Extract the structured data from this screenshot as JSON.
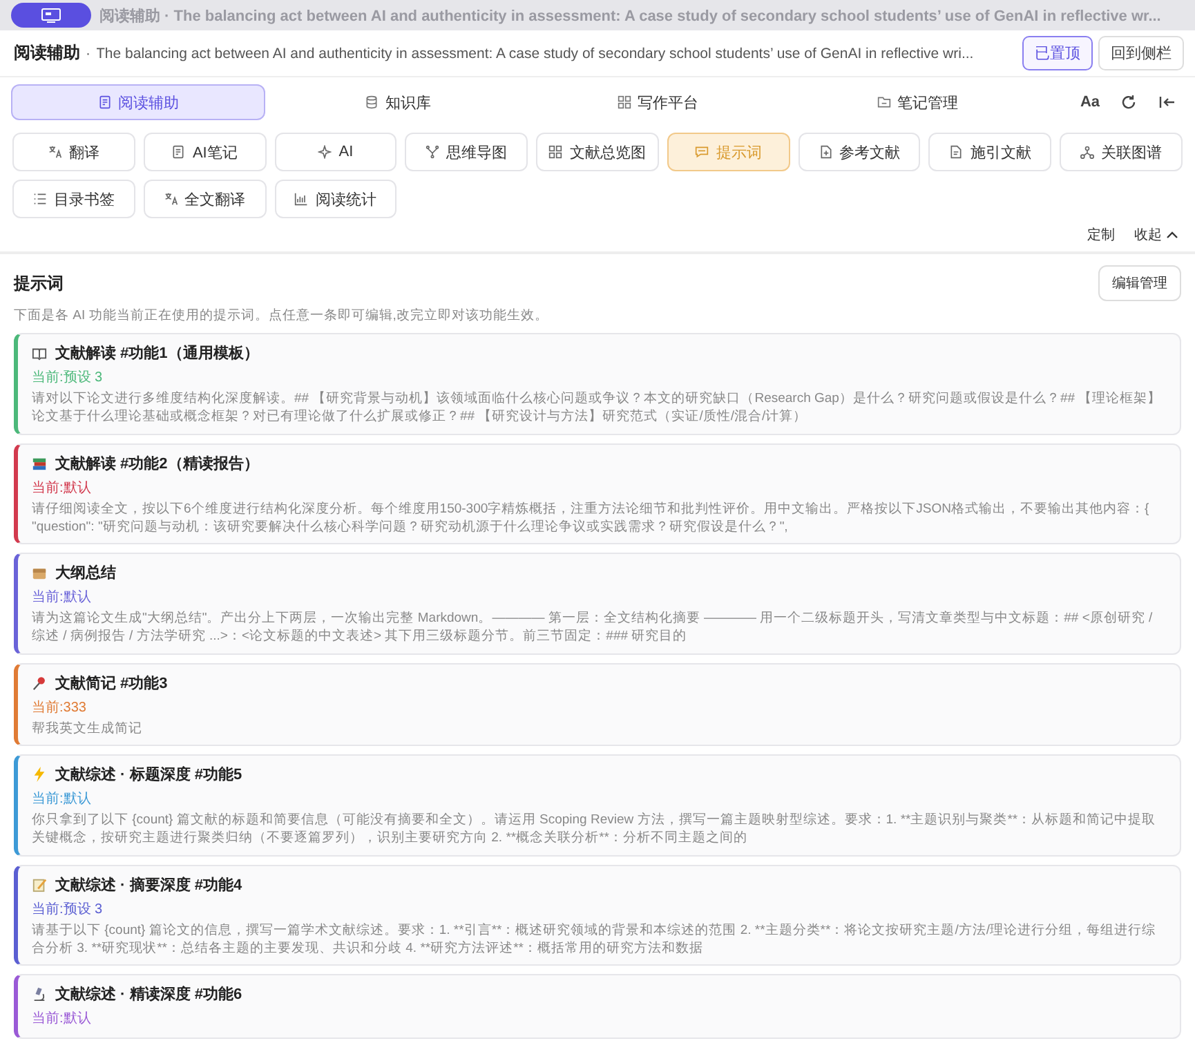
{
  "top_bar": {
    "title": "阅读辅助 · The balancing act between AI and authenticity in assessment: A case study of secondary school students’ use of GenAI in reflective wr..."
  },
  "header": {
    "module": "阅读辅助",
    "separator": "·",
    "title": "The balancing act between AI and authenticity in assessment: A case study of secondary school students’ use of GenAI in reflective wri...",
    "buttons": [
      {
        "label": "已置顶",
        "selected": true
      },
      {
        "label": "回到侧栏",
        "selected": false
      }
    ]
  },
  "tabs": [
    {
      "label": "阅读辅助",
      "selected": true
    },
    {
      "label": "知识库",
      "selected": false
    },
    {
      "label": "写作平台",
      "selected": false
    },
    {
      "label": "笔记管理",
      "selected": false
    }
  ],
  "font_button": "Aa",
  "tools": [
    {
      "label": "翻译",
      "selected": false
    },
    {
      "label": "AI笔记",
      "selected": false
    },
    {
      "label": "AI",
      "selected": false
    },
    {
      "label": "思维导图",
      "selected": false
    },
    {
      "label": "文献总览图",
      "selected": false
    },
    {
      "label": "提示词",
      "selected": true
    },
    {
      "label": "参考文献",
      "selected": false
    },
    {
      "label": "施引文献",
      "selected": false
    },
    {
      "label": "关联图谱",
      "selected": false
    },
    {
      "label": "目录书签",
      "selected": false
    },
    {
      "label": "全文翻译",
      "selected": false
    },
    {
      "label": "阅读统计",
      "selected": false
    }
  ],
  "tool_actions": {
    "customize": "定制",
    "collapse": "收起"
  },
  "panel": {
    "title": "提示词",
    "manage_button": "编辑管理",
    "description": "下面是各 AI 功能当前正在使用的提示词。点任意一条即可编辑,改完立即对该功能生效。"
  },
  "prompts": [
    {
      "kind": "book",
      "title": "文献解读 #功能1（通用模板）",
      "current": "当前:预设 3",
      "color": "#4cb87a",
      "text": "请对以下论文进行多维度结构化深度解读。## 【研究背景与动机】该领域面临什么核心问题或争议？本文的研究缺口（Research Gap）是什么？研究问题或假设是什么？## 【理论框架】论文基于什么理论基础或概念框架？对已有理论做了什么扩展或修正？## 【研究设计与方法】研究范式（实证/质性/混合/计算）"
    },
    {
      "kind": "books",
      "title": "文献解读 #功能2（精读报告）",
      "current": "当前:默认",
      "color": "#d23a4e",
      "text": "请仔细阅读全文，按以下6个维度进行结构化深度分析。每个维度用150-300字精炼概括，注重方法论细节和批判性评价。用中文输出。严格按以下JSON格式输出，不要输出其他内容：{ \"question\": \"研究问题与动机：该研究要解决什么核心科学问题？研究动机源于什么理论争议或实践需求？研究假设是什么？\","
    },
    {
      "kind": "box",
      "title": "大纲总结",
      "current": "当前:默认",
      "color": "#6a63d8",
      "text": "请为这篇论文生成\"大纲总结\"。产出分上下两层，一次输出完整 Markdown。———— 第一层：全文结构化摘要 ———— 用一个二级标题开头，写清文章类型与中文标题：## <原创研究 / 综述 / 病例报告 / 方法学研究 ...>：<论文标题的中文表述> 其下用三级标题分节。前三节固定：### 研究目的"
    },
    {
      "kind": "pin",
      "title": "文献简记 #功能3",
      "current": "当前:333",
      "color": "#e07b35",
      "text": "帮我英文生成简记"
    },
    {
      "kind": "bolt",
      "title": "文献综述 · 标题深度 #功能5",
      "current": "当前:默认",
      "color": "#3d9ad6",
      "text": "你只拿到了以下 {count} 篇文献的标题和简要信息（可能没有摘要和全文）。请运用 Scoping Review 方法，撰写一篇主题映射型综述。要求：1. **主题识别与聚类**：从标题和简记中提取关键概念，按研究主题进行聚类归纳（不要逐篇罗列），识别主要研究方向 2. **概念关联分析**：分析不同主题之间的"
    },
    {
      "kind": "memo",
      "title": "文献综述 · 摘要深度 #功能4",
      "current": "当前:预设 3",
      "color": "#5b5fd2",
      "text": "请基于以下 {count} 篇论文的信息，撰写一篇学术文献综述。要求：1. **引言**：概述研究领域的背景和本综述的范围 2. **主题分类**：将论文按研究主题/方法/理论进行分组，每组进行综合分析 3. **研究现状**：总结各主题的主要发现、共识和分歧 4. **研究方法评述**：概括常用的研究方法和数据"
    },
    {
      "kind": "microscope",
      "title": "文献综述 · 精读深度 #功能6",
      "current": "当前:默认",
      "color": "#9a5ad6"
    }
  ]
}
